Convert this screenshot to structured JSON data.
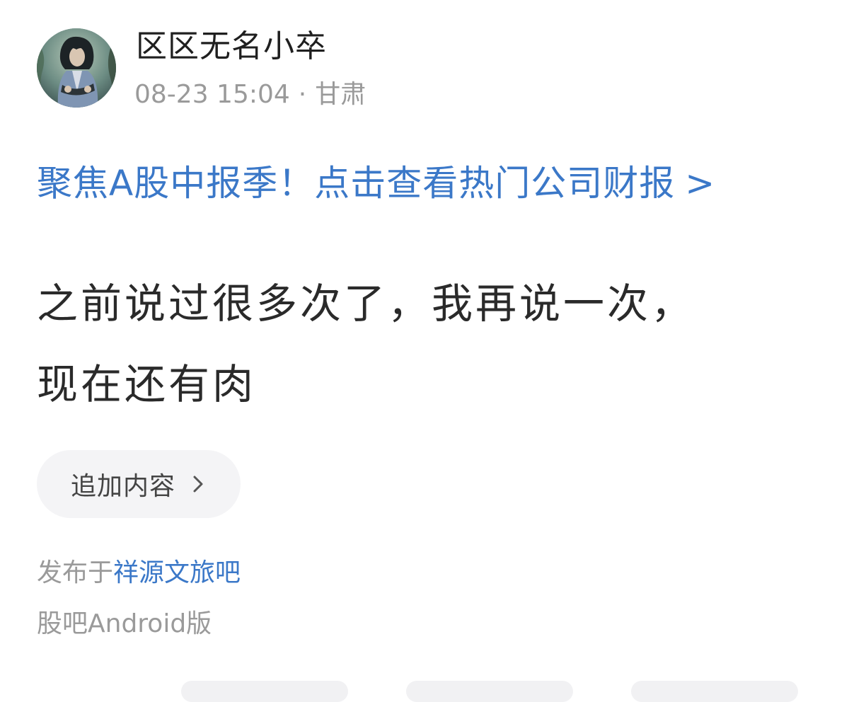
{
  "author": {
    "name": "区区无名小卒",
    "avatar_icon": "user-avatar"
  },
  "meta": {
    "time": "08-23 15:04",
    "separator": "·",
    "location": "甘肃"
  },
  "promo": {
    "text": "聚焦A股中报季！点击查看热门公司财报",
    "chevron": ">",
    "color": "#3b78c8"
  },
  "post": {
    "lines": [
      "之前说过很多次了，我再说一次，",
      "现在还有肉"
    ]
  },
  "append_button": {
    "label": "追加内容",
    "icon": "chevron-right-icon"
  },
  "published": {
    "prefix": "发布于",
    "bar_name": "祥源文旅吧"
  },
  "client": {
    "text": "股吧Android版"
  },
  "colors": {
    "link": "#3b78c8",
    "muted": "#9a9a9a",
    "text": "#2a2a2a",
    "button_bg": "#f4f4f6"
  }
}
